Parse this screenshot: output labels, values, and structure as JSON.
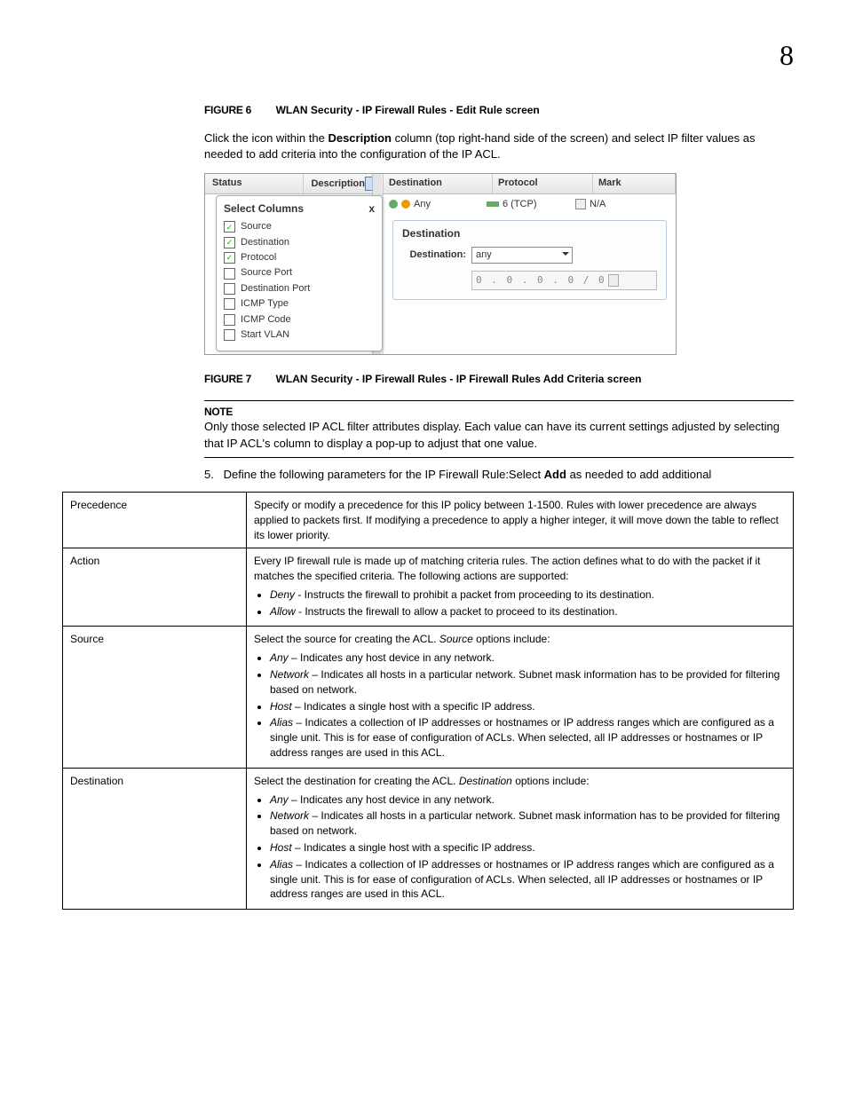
{
  "page_number": "8",
  "figure6": {
    "label": "FIGURE 6",
    "title": "WLAN Security - IP Firewall Rules - Edit Rule screen"
  },
  "intro": {
    "part1": "Click the icon within the ",
    "bold": "Description",
    "part2": " column (top right-hand side of the screen) and select IP filter values as needed to add criteria into the configuration of the IP ACL."
  },
  "screenshot": {
    "header_status": "Status",
    "header_description": "Description",
    "popup_title": "Select Columns",
    "popup_close": "x",
    "columns": [
      {
        "label": "Source",
        "checked": true
      },
      {
        "label": "Destination",
        "checked": true
      },
      {
        "label": "Protocol",
        "checked": true
      },
      {
        "label": "Source Port",
        "checked": false
      },
      {
        "label": "Destination Port",
        "checked": false
      },
      {
        "label": "ICMP Type",
        "checked": false
      },
      {
        "label": "ICMP Code",
        "checked": false
      },
      {
        "label": "Start VLAN",
        "checked": false
      }
    ],
    "right_headers": {
      "destination": "Destination",
      "protocol": "Protocol",
      "mark": "Mark"
    },
    "row": {
      "destination": "Any",
      "protocol": "6 (TCP)",
      "mark": "N/A"
    },
    "panel": {
      "title": "Destination",
      "field_label": "Destination:",
      "select_value": "any",
      "ip_value": "0 . 0 . 0 . 0 / 0"
    }
  },
  "figure7": {
    "label": "FIGURE 7",
    "title": "WLAN Security - IP Firewall Rules - IP Firewall Rules Add Criteria screen"
  },
  "note": {
    "label": "NOTE",
    "text": "Only those selected IP ACL filter attributes display. Each value can have its current settings adjusted by selecting that IP ACL's column to display a pop-up to adjust that one value."
  },
  "step5": {
    "num": "5.",
    "text1": "Define the following parameters for the IP Firewall Rule:Select ",
    "bold": "Add",
    "text2": " as needed to add additional"
  },
  "params": [
    {
      "name": "Precedence",
      "desc_plain": "Specify or modify a precedence for this IP policy between 1-1500. Rules with lower precedence are always applied to packets first. If modifying a precedence to apply a higher integer, it will move down the table to reflect its lower priority."
    },
    {
      "name": "Action",
      "desc_intro": "Every IP firewall rule is made up of matching criteria rules. The action defines what to do with the packet if it matches the specified criteria. The following actions are supported:",
      "items": [
        {
          "term": "Deny",
          "text": " - Instructs the firewall to prohibit a packet from proceeding to its destination."
        },
        {
          "term": "Allow",
          "text": " - Instructs the firewall to allow a packet to proceed to its destination."
        }
      ]
    },
    {
      "name": "Source",
      "desc_intro_pre": "Select the source for creating the ACL. ",
      "desc_intro_it": "Source",
      "desc_intro_post": " options include:",
      "items": [
        {
          "term": "Any",
          "text": " – Indicates any host device in any network."
        },
        {
          "term": "Network",
          "text": " – Indicates all hosts in a particular network. Subnet mask information has to be provided for filtering based on network."
        },
        {
          "term": "Host",
          "text": " – Indicates a single host with a specific IP address."
        },
        {
          "term": "Alias",
          "text": " – Indicates a collection of IP addresses or hostnames or IP address ranges which are configured as a single unit. This is for ease of configuration of ACLs. When selected, all IP addresses or hostnames or IP address ranges are used in this ACL."
        }
      ]
    },
    {
      "name": "Destination",
      "desc_intro_pre": "Select the destination for creating the ACL. ",
      "desc_intro_it": "Destination",
      "desc_intro_post": " options include:",
      "items": [
        {
          "term": "Any",
          "text": " – Indicates any host device in any network."
        },
        {
          "term": "Network",
          "text": " – Indicates all hosts in a particular network. Subnet mask information has to be provided for filtering based on network."
        },
        {
          "term": "Host",
          "text": " – Indicates a single host with a specific IP address."
        },
        {
          "term": "Alias",
          "text": " – Indicates a collection of IP addresses or hostnames or IP address ranges which are configured as a single unit. This is for ease of configuration of ACLs. When selected, all IP addresses or hostnames or IP address ranges are used in this ACL."
        }
      ]
    }
  ]
}
